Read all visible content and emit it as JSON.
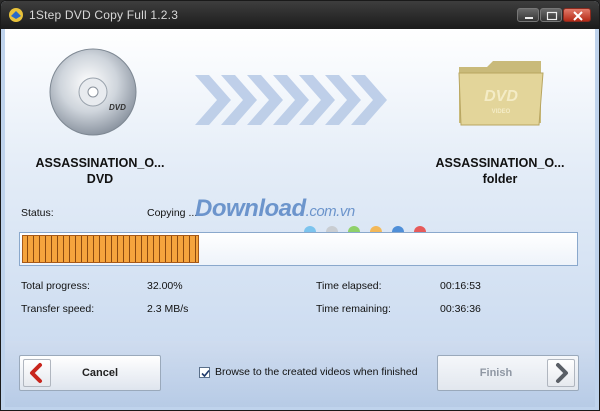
{
  "window": {
    "title": "1Step DVD Copy Full 1.2.3",
    "minimize_icon": "minimize-icon",
    "maximize_icon": "maximize-icon",
    "close_icon": "close-icon"
  },
  "source": {
    "name": "ASSASSINATION_O...",
    "type": "DVD",
    "icon": "dvd-disc-icon",
    "disc_label": "DVD"
  },
  "destination": {
    "name": "ASSASSINATION_O...",
    "type": "folder",
    "icon": "dvd-folder-icon",
    "folder_label": "DVD",
    "folder_sublabel": "VIDEO"
  },
  "status": {
    "label": "Status:",
    "value": "Copying ..."
  },
  "watermark": {
    "main": "Download",
    "suffix": ".com.vn",
    "dot_colors": [
      "#7cc4ee",
      "#c9cdd2",
      "#8fd16a",
      "#f3b858",
      "#4f8fd8",
      "#e65a5a"
    ]
  },
  "progress": {
    "fraction": 0.32,
    "fill_color": "#f5a43d"
  },
  "stats": {
    "total_progress_label": "Total progress:",
    "total_progress_value": "32.00%",
    "transfer_speed_label": "Transfer speed:",
    "transfer_speed_value": "2.3 MB/s",
    "time_elapsed_label": "Time elapsed:",
    "time_elapsed_value": "00:16:53",
    "time_remaining_label": "Time remaining:",
    "time_remaining_value": "00:36:36"
  },
  "footer": {
    "cancel_label": "Cancel",
    "finish_label": "Finish",
    "browse_checkbox_label": "Browse to the created videos when finished",
    "browse_checked": true
  },
  "colors": {
    "accent_red": "#c8251c",
    "arrow_blue": "#9cb6dc"
  }
}
